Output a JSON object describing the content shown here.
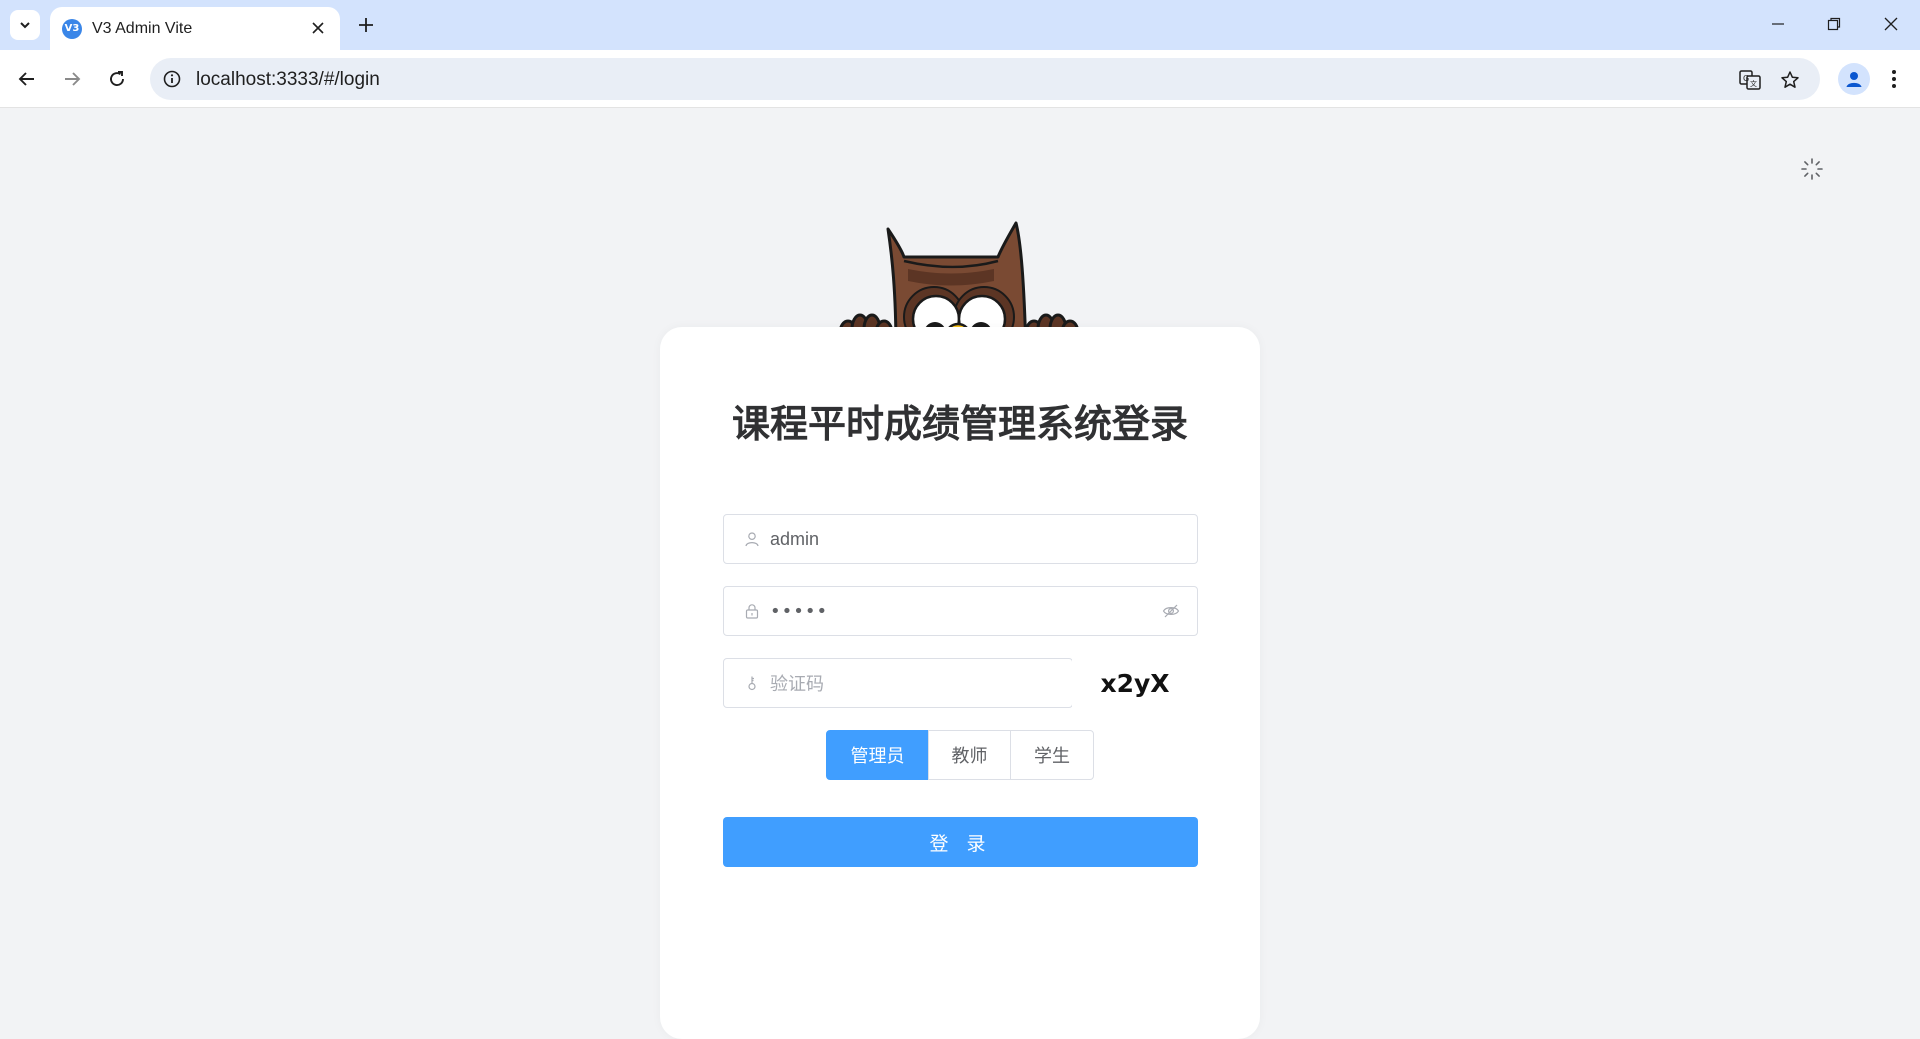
{
  "browser": {
    "tab_title": "V3 Admin Vite",
    "favicon_text": "V3",
    "url": "localhost:3333/#/login"
  },
  "login": {
    "title": "课程平时成绩管理系统登录",
    "username_value": "admin",
    "password_mask": "•••••",
    "captcha_placeholder": "验证码",
    "captcha_text": "x2yX",
    "roles": [
      "管理员",
      "教师",
      "学生"
    ],
    "selected_role": "管理员",
    "submit_label": "登 录"
  },
  "colors": {
    "primary": "#409eff",
    "page_bg": "#f2f3f5",
    "tabbar_bg": "#d3e3fd"
  },
  "icons": {
    "username": "user-icon",
    "password": "lock-icon",
    "password_toggle": "eye-hidden-icon",
    "captcha": "key-icon",
    "theme": "theme-switch-icon",
    "mascot": "owl-mascot"
  }
}
